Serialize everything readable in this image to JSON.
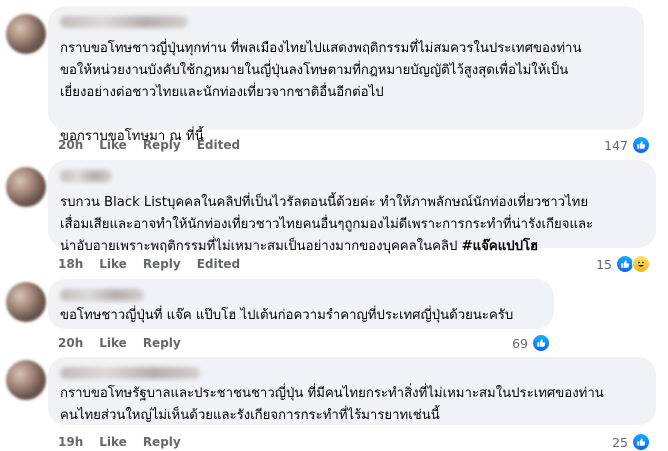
{
  "comments": [
    {
      "text": "กราบขอโทษชาวญี่ปุ่นทุกท่าน ที่พลเมืองไทยไปแสดงพฤติกรรมที่ไม่สมควรในประเทศของท่าน\nขอให้หน่วยงานบังคับใช้กฎหมายในญี่ปุ่นลงโทษตามที่กฎหมายบัญญัติไว้สูงสุดเพื่อไม่ให้เป็น\nเยี่ยงอย่างต่อชาวไทยและนักท่องเที่ยวจากชาติอื่นอีกต่อไป\n\nขอกราบขอโทษมา ณ ที่นี้",
      "time": "20h",
      "like": "Like",
      "reply": "Reply",
      "edited": "Edited",
      "count": "147"
    },
    {
      "text": "รบกวน Black Listบุคคลในคลิปที่เป็นไวรัลตอนนี้ด้วยค่ะ ทำให้ภาพลักษณ์นักท่องเที่ยวชาวไทย\nเสื่อมเสียและอาจทำให้นักท่องเที่ยวชาวไทยคนอื่นๆถูกมองไม่ดีเพราะการกระทำที่น่ารังเกียจและ\nน่าอับอายเพราะพฤติกรรมที่ไม่เหมาะสมเป็นอย่างมากของบุคคลในคลิป ",
      "tag": "#แจ๊คแปปโฮ",
      "time": "18h",
      "like": "Like",
      "reply": "Reply",
      "edited": "Edited",
      "count": "15"
    },
    {
      "text": "ขอโทษชาวญี่ปุ่นที่ แจ๊ค แป๊บโฮ ไปเต้นก่อความรำคาญที่ประเทศญี่ปุ่นด้วยนะครับ",
      "time": "20h",
      "like": "Like",
      "reply": "Reply",
      "count": "69"
    },
    {
      "text": "กราบขอโทษรัฐบาลและประชาชนชาวญี่ปุ่น ที่มีคนไทยกระทำสิ่งที่ไม่เหมาะสมในประเทศของท่าน\nคนไทยส่วนใหญ่ไม่เห็นด้วยและรังเกียจการกระทำที่ไร้มารยาทเช่นนี้",
      "time": "19h",
      "like": "Like",
      "reply": "Reply",
      "count": "25"
    }
  ],
  "icons": {
    "like": "like-reaction-icon",
    "haha": "haha-reaction-icon"
  },
  "colors": {
    "bubble": "#f0f2f5",
    "meta": "#65676b",
    "like_blue": "#0866ff"
  }
}
